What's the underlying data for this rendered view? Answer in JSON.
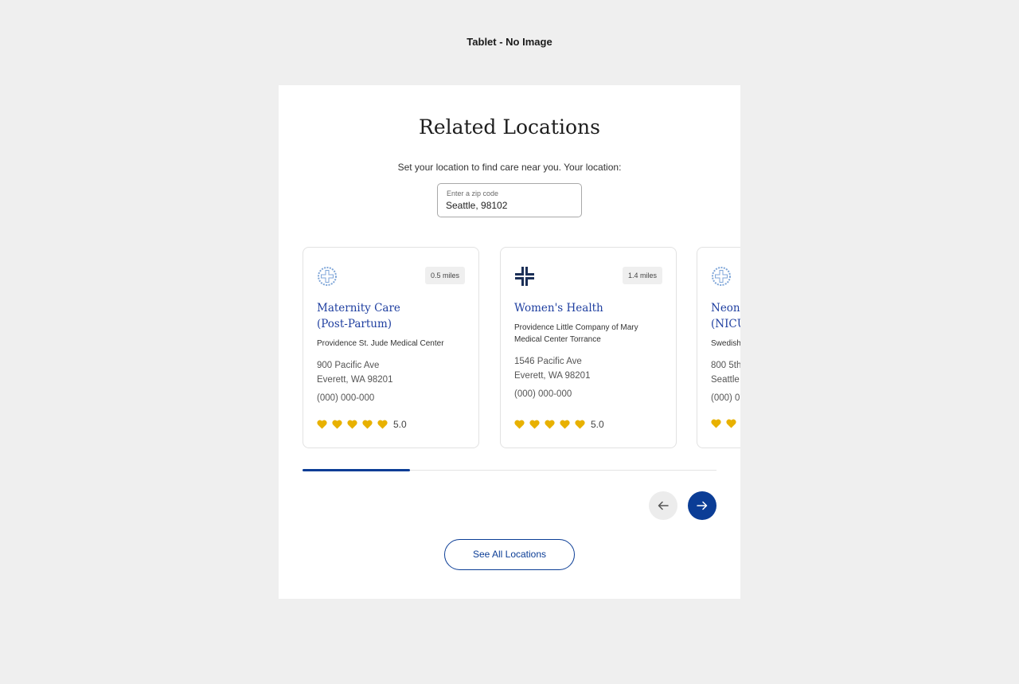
{
  "frame_label": "Tablet - No Image",
  "section": {
    "title": "Related Locations",
    "subtitle": "Set your location to find care near you. Your location:"
  },
  "zip_field": {
    "label": "Enter a zip code",
    "value": "Seattle, 98102"
  },
  "cards": [
    {
      "logo": "providence-cross-icon",
      "distance": "0.5 miles",
      "name_lines": [
        "Maternity Care",
        "(Post-Partum)"
      ],
      "organization_lines": [
        "Providence St. Jude Medical Center"
      ],
      "address_lines": [
        "900 Pacific Ave",
        "Everett, WA 98201"
      ],
      "phone": "(000) 000-000",
      "rating": "5.0",
      "hearts": 5
    },
    {
      "logo": "swedish-cross-icon",
      "distance": "1.4 miles",
      "name_lines": [
        "Women's Health"
      ],
      "organization_lines": [
        "Providence Little Company of Mary",
        "Medical Center Torrance"
      ],
      "address_lines": [
        "1546 Pacific Ave",
        "Everett, WA 98201"
      ],
      "phone": "(000) 000-000",
      "rating": "5.0",
      "hearts": 5
    },
    {
      "logo": "providence-cross-icon",
      "distance": "",
      "name_lines": [
        "Neona",
        "(NICU"
      ],
      "organization_lines": [
        "Swedish"
      ],
      "address_lines": [
        "800 5th",
        "Seattle"
      ],
      "phone": "(000) 0",
      "rating": "",
      "hearts": 2
    }
  ],
  "carousel": {
    "progress_fraction": 0.26,
    "prev_icon": "arrow-left-icon",
    "next_icon": "arrow-right-icon"
  },
  "see_all_label": "See All Locations",
  "colors": {
    "brand_blue": "#0b3d96",
    "heading_blue": "#1f3fa0",
    "heart_gold": "#e8b100",
    "logo_light_blue": "#7fa6d8",
    "logo_dark_navy": "#1b2f57"
  }
}
